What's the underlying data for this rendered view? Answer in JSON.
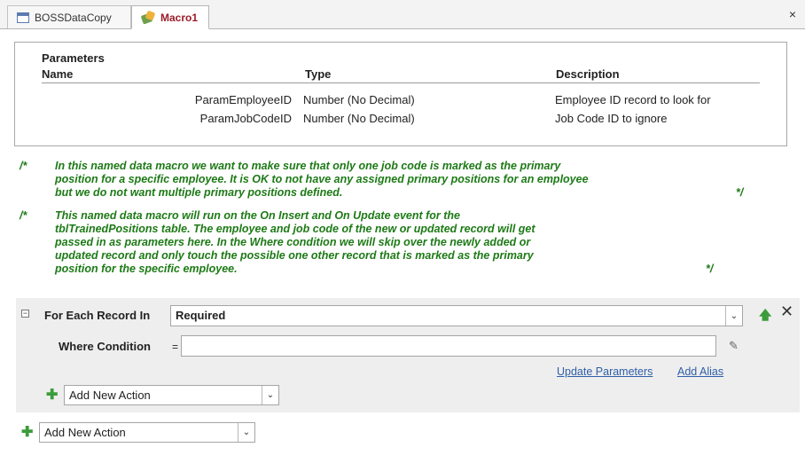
{
  "tabs": [
    {
      "label": "BOSSDataCopy",
      "icon": "table-icon"
    },
    {
      "label": "Macro1",
      "icon": "macro-icon"
    }
  ],
  "close_glyph": "×",
  "parameters": {
    "title": "Parameters",
    "columns": {
      "name": "Name",
      "type": "Type",
      "description": "Description"
    },
    "rows": [
      {
        "name": "ParamEmployeeID",
        "type": "Number (No Decimal)",
        "description": "Employee ID record to look for"
      },
      {
        "name": "ParamJobCodeID",
        "type": "Number (No Decimal)",
        "description": "Job Code ID to ignore"
      }
    ]
  },
  "comments": [
    {
      "open": "/*",
      "lines": [
        "In this named data macro we want to make sure that only one job code is marked as the primary",
        "position for a specific employee. It is OK to not have any assigned primary positions for an employee",
        "but we do not want multiple primary positions defined."
      ],
      "close": "*/"
    },
    {
      "open": "/*",
      "lines": [
        "This named data macro will run on the On Insert and On Update event for the",
        "tblTrainedPositions table. The employee and job code of the new or updated record will get",
        "passed in as parameters here. In the Where condition we will skip over the newly added or",
        "updated record and only touch the possible one other record that is marked as the primary",
        "position for the specific employee."
      ],
      "close": "*/"
    }
  ],
  "for_each": {
    "label": "For Each Record In",
    "value": "Required",
    "where_label": "Where Condition",
    "where_eq": "=",
    "where_value": "",
    "update_parameters": "Update Parameters",
    "add_alias": "Add Alias",
    "inner_add_action": "Add New Action"
  },
  "outer_add_action": "Add New Action",
  "colors": {
    "comment": "#1d7a16",
    "link": "#2f5fa8",
    "plus": "#3b9c3b",
    "block_bg": "#eeeeee"
  }
}
